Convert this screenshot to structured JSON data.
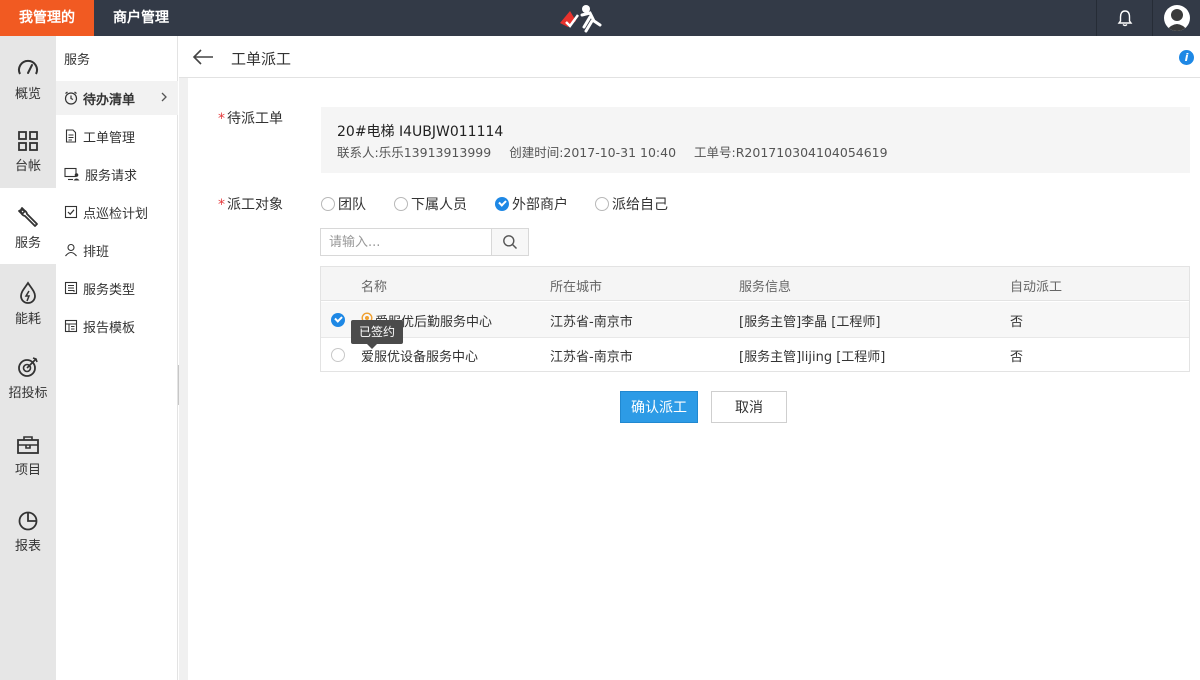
{
  "topbar": {
    "brand": "我管理的",
    "tab": "商户管理",
    "logo_icon": "runner-logo-icon",
    "notification_icon": "bell-icon",
    "avatar_icon": "user-avatar-icon"
  },
  "rail": [
    {
      "label": "概览",
      "icon": "gauge-icon"
    },
    {
      "label": "台帐",
      "icon": "grid-icon"
    },
    {
      "label": "服务",
      "icon": "wrench-icon",
      "active": true
    },
    {
      "label": "能耗",
      "icon": "energy-drop-icon"
    },
    {
      "label": "招投标",
      "icon": "target-icon"
    },
    {
      "label": "项目",
      "icon": "briefcase-icon"
    },
    {
      "label": "报表",
      "icon": "pie-chart-icon"
    }
  ],
  "sidebar": {
    "heading": "服务",
    "items": [
      {
        "label": "待办清单",
        "icon": "alarm-clock-icon",
        "active": true
      },
      {
        "label": "工单管理",
        "icon": "document-icon"
      },
      {
        "label": "服务请求",
        "icon": "monitor-user-icon"
      },
      {
        "label": "点巡检计划",
        "icon": "check-calendar-icon"
      },
      {
        "label": "排班",
        "icon": "person-icon"
      },
      {
        "label": "服务类型",
        "icon": "service-type-icon"
      },
      {
        "label": "报告模板",
        "icon": "report-template-icon"
      }
    ]
  },
  "page": {
    "title": "工单派工",
    "info_icon": "info-icon"
  },
  "form": {
    "work_order_label": "待派工单",
    "work_order": {
      "name": "20#电梯 I4UBJW011114",
      "contact": "联系人:乐乐13913913999",
      "created": "创建时间:2017-10-31 10:40",
      "number": "工单号:R201710304104054619"
    },
    "dispatch_label": "派工对象",
    "dispatch_options": [
      {
        "label": "团队",
        "selected": false
      },
      {
        "label": "下属人员",
        "selected": false
      },
      {
        "label": "外部商户",
        "selected": true
      },
      {
        "label": "派给自己",
        "selected": false
      }
    ],
    "search": {
      "placeholder": "请输入...",
      "value": ""
    },
    "table": {
      "columns": [
        "名称",
        "所在城市",
        "服务信息",
        "自动派工"
      ],
      "rows": [
        {
          "name": "爱服优后勤服务中心",
          "city": "江苏省-南京市",
          "service": "[服务主管]李晶 [工程师]",
          "auto": "否",
          "selected": true,
          "signed_badge": true
        },
        {
          "name": "爱服优设备服务中心",
          "city": "江苏省-南京市",
          "service": "[服务主管]lijing [工程师]",
          "auto": "否",
          "selected": false,
          "signed_badge": false
        }
      ]
    },
    "tooltip": "已签约",
    "confirm_label": "确认派工",
    "cancel_label": "取消"
  },
  "colors": {
    "brand": "#f15a22",
    "topbar": "#333a47",
    "primary": "#2d9be6",
    "required": "#e4393c"
  }
}
